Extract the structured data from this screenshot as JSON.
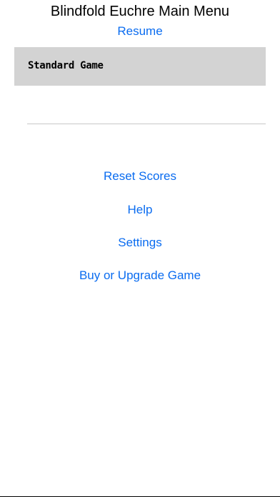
{
  "header": {
    "title": "Blindfold Euchre Main Menu"
  },
  "menu": {
    "resume_label": "Resume",
    "game_types": [
      "Standard Game"
    ],
    "reset_scores_label": "Reset Scores",
    "help_label": "Help",
    "settings_label": "Settings",
    "buy_upgrade_label": "Buy or Upgrade Game"
  },
  "colors": {
    "link": "#0a6cf0",
    "selected_row": "#d3d3d3"
  }
}
